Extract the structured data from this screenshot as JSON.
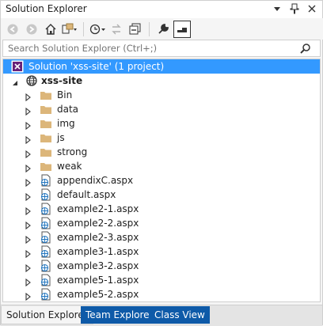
{
  "window": {
    "title": "Solution Explorer"
  },
  "search": {
    "placeholder": "Search Solution Explorer (Ctrl+;)"
  },
  "tree": {
    "solution_label": "Solution 'xss-site' (1 project)",
    "project_label": "xss-site",
    "items": [
      {
        "label": "Bin",
        "type": "folder"
      },
      {
        "label": "data",
        "type": "folder"
      },
      {
        "label": "img",
        "type": "folder"
      },
      {
        "label": "js",
        "type": "folder"
      },
      {
        "label": "strong",
        "type": "folder"
      },
      {
        "label": "weak",
        "type": "folder"
      },
      {
        "label": "appendixC.aspx",
        "type": "aspx"
      },
      {
        "label": "default.aspx",
        "type": "aspx"
      },
      {
        "label": "example2-1.aspx",
        "type": "aspx"
      },
      {
        "label": "example2-2.aspx",
        "type": "aspx"
      },
      {
        "label": "example2-3.aspx",
        "type": "aspx"
      },
      {
        "label": "example3-1.aspx",
        "type": "aspx"
      },
      {
        "label": "example3-2.aspx",
        "type": "aspx"
      },
      {
        "label": "example5-1.aspx",
        "type": "aspx"
      },
      {
        "label": "example5-2.aspx",
        "type": "aspx"
      }
    ]
  },
  "tabs": [
    {
      "label": "Solution Explorer",
      "active": true
    },
    {
      "label": "Team Explorer",
      "active": false
    },
    {
      "label": "Class View",
      "active": false
    }
  ],
  "colors": {
    "selection": "#3399ff",
    "tab_inactive": "#0e5aa8",
    "folder": "#dcb67a"
  }
}
